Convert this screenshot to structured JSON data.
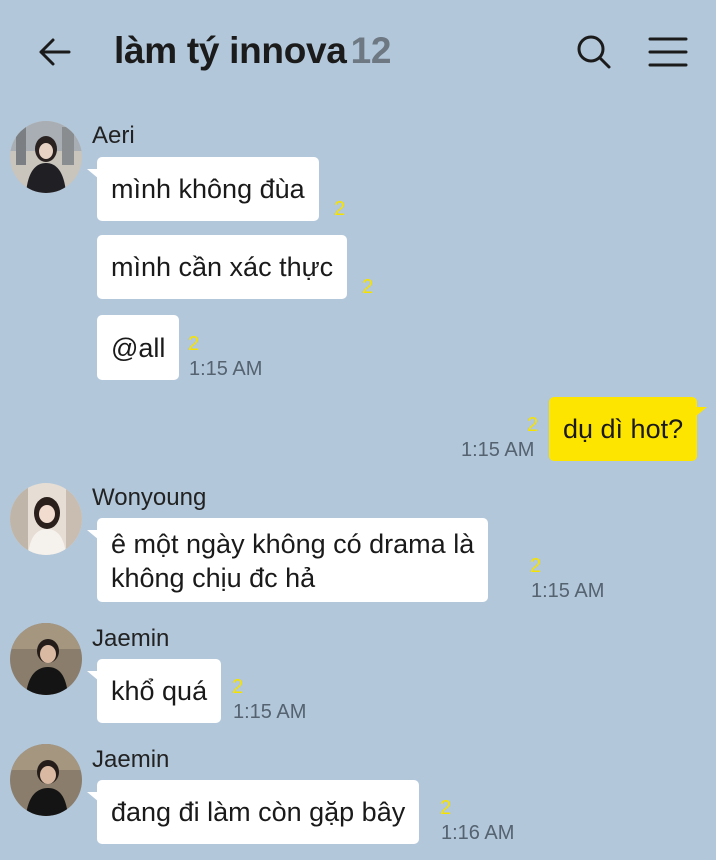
{
  "header": {
    "title": "làm tý innova",
    "member_count": "12",
    "back_icon": "arrow-left-icon",
    "search_icon": "search-icon",
    "menu_icon": "hamburger-menu-icon"
  },
  "messages": [
    {
      "sender": "Aeri",
      "text": "mình không đùa",
      "unread": "2",
      "time": ""
    },
    {
      "sender": "",
      "text": "mình cần xác thực",
      "unread": "2",
      "time": ""
    },
    {
      "sender": "",
      "text": "@all",
      "unread": "2",
      "time": "1:15 AM"
    },
    {
      "sender": "me",
      "text": "dụ dì hot?",
      "unread": "2",
      "time": "1:15 AM"
    },
    {
      "sender": "Wonyoung",
      "text_line1": "ê một ngày không có drama là",
      "text_line2": "không chịu đc hả",
      "unread": "2",
      "time": "1:15 AM"
    },
    {
      "sender": "Jaemin",
      "text": "khổ quá",
      "unread": "2",
      "time": "1:15 AM"
    },
    {
      "sender": "Jaemin",
      "text": "đang đi làm còn gặp bây",
      "unread": "2",
      "time": "1:16 AM"
    }
  ],
  "colors": {
    "background": "#b2c7da",
    "my_bubble": "#fee500",
    "other_bubble": "#ffffff",
    "unread": "#f6e200"
  }
}
